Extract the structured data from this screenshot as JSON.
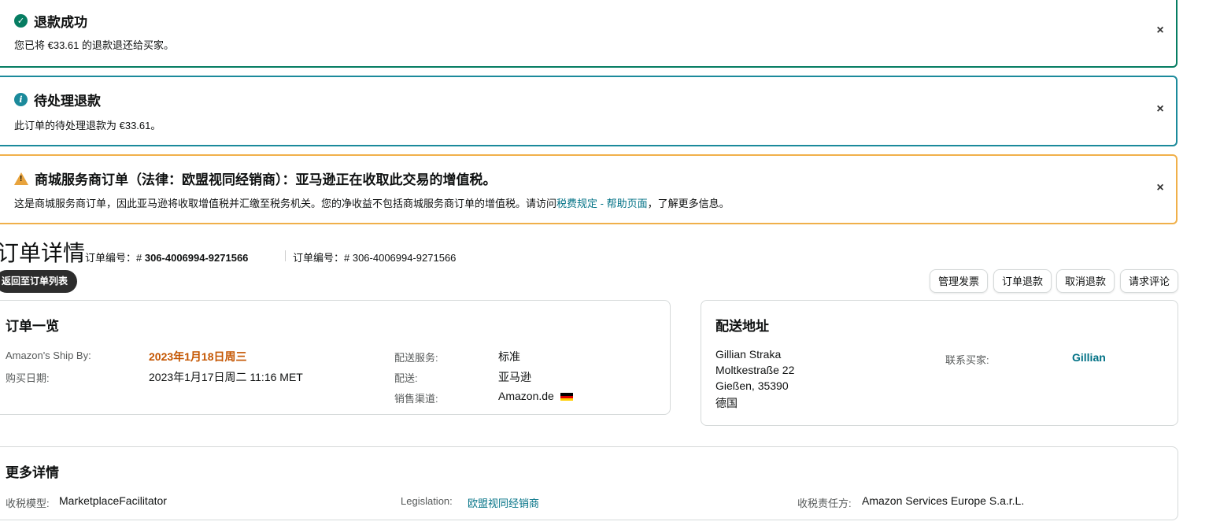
{
  "alerts": {
    "success": {
      "title": "退款成功",
      "body": "您已将 €33.61 的退款退还给买家。",
      "close": "×"
    },
    "pending": {
      "title": "待处理退款",
      "body": "此订单的待处理退款为 €33.61。",
      "close": "×"
    },
    "warning": {
      "title": "商城服务商订单（法律：欧盟视同经销商）：亚马逊正在收取此交易的增值税。",
      "body_prefix": "这是商城服务商订单，因此亚马逊将收取增值税并汇缴至税务机关。您的净收益不包括商城服务商订单的增值税。请访问",
      "link": "税费规定 - 帮助页面",
      "body_suffix": "，了解更多信息。",
      "close": "×"
    }
  },
  "header": {
    "title": "订单详情",
    "order_label_1": "订单编号：# ",
    "order_number_1": "306-4006994-9271566",
    "order_label_2": "订单编号：# 306-4006994-9271566",
    "back_button": "返回至订单列表"
  },
  "actions": [
    "管理发票",
    "订单退款",
    "取消退款",
    "请求评论"
  ],
  "order_summary": {
    "title": "订单一览",
    "ship_by_label": "Amazon's Ship By:",
    "ship_by_value": "2023年1月18日周三",
    "purchase_date_label": "购买日期:",
    "purchase_date_value": "2023年1月17日周二 11:16 MET",
    "shipping_service_label": "配送服务:",
    "shipping_service_value": "标准",
    "fulfillment_label": "配送:",
    "fulfillment_value": "亚马逊",
    "sales_channel_label": "销售渠道:",
    "sales_channel_value": "Amazon.de"
  },
  "shipping_address": {
    "title": "配送地址",
    "lines": [
      "Gillian Straka",
      "Moltkestraße 22",
      "Gießen, 35390",
      "德国"
    ],
    "contact_label": "联系买家:",
    "contact_name": "Gillian"
  },
  "more_details": {
    "title": "更多详情",
    "tax_model_label": "收税模型:",
    "tax_model_value": "MarketplaceFacilitator",
    "legislation_label": "Legislation:",
    "legislation_value": "欧盟视同经销商",
    "tax_party_label": "收税责任方:",
    "tax_party_value": "Amazon Services Europe S.a.r.L."
  },
  "colors": {
    "success": "#067d62",
    "info": "#1b8a9b",
    "warning": "#f0b04a",
    "link": "#007185",
    "ship_by": "#c45500"
  }
}
